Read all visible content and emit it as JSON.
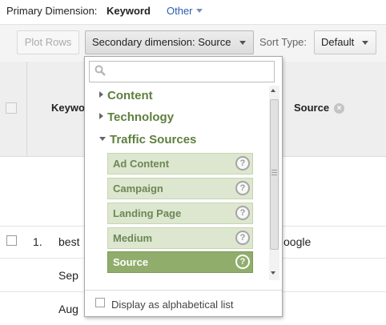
{
  "primary_dimension": {
    "label": "Primary Dimension:",
    "selected": "Keyword",
    "other": "Other"
  },
  "toolbar": {
    "plot_rows": "Plot Rows",
    "secondary_dimension": "Secondary dimension: Source",
    "sort_type_label": "Sort Type:",
    "sort_type_value": "Default"
  },
  "table": {
    "header": {
      "keyword": "Keywo",
      "source": "Source"
    },
    "rows": [
      {
        "index": "1.",
        "keyword": "best",
        "source": "oogle"
      },
      {
        "keyword": "Sep"
      },
      {
        "keyword": "Aug"
      }
    ]
  },
  "dropdown": {
    "search_placeholder": "",
    "groups": [
      {
        "label": "Content",
        "expanded": false
      },
      {
        "label": "Technology",
        "expanded": false
      },
      {
        "label": "Traffic Sources",
        "expanded": true
      }
    ],
    "items": [
      {
        "label": "Ad Content",
        "selected": false
      },
      {
        "label": "Campaign",
        "selected": false
      },
      {
        "label": "Landing Page",
        "selected": false
      },
      {
        "label": "Medium",
        "selected": false
      },
      {
        "label": "Source",
        "selected": true
      }
    ],
    "help_glyph": "?",
    "alphabetical_label": "Display as alphabetical list"
  },
  "icons": {
    "search": "search-icon",
    "help": "help-icon",
    "remove": "remove-dimension-icon",
    "caret": "chevron-down-icon",
    "expand": "expand-arrow-icon",
    "collapse": "collapse-arrow-icon"
  },
  "colors": {
    "link": "#2a5db0",
    "group_text": "#5f7f3e",
    "item_bg": "#dde7cf",
    "item_selected_bg": "#90ad6c"
  }
}
